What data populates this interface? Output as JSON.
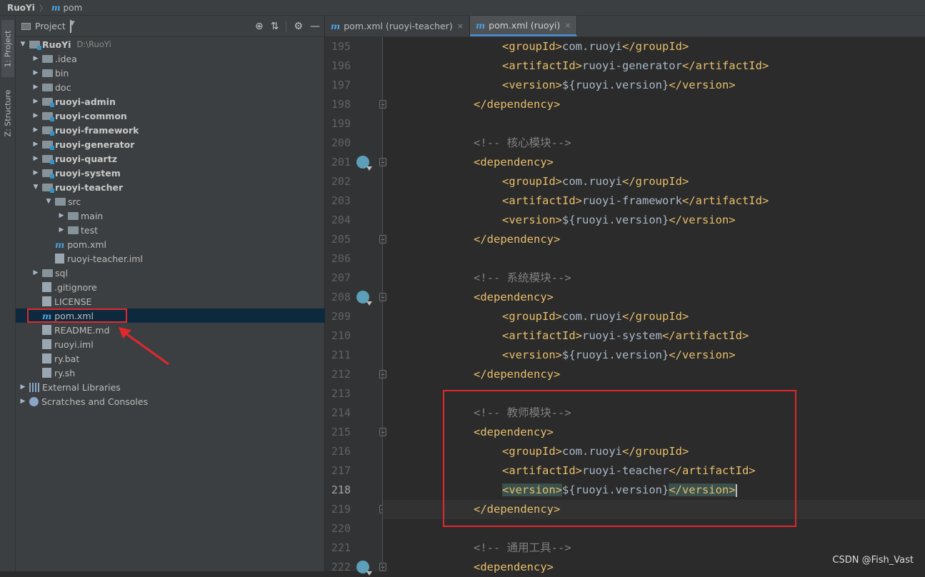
{
  "breadcrumb": {
    "root": "RuoYi",
    "separator": "〉",
    "file_icon": "m",
    "file": "pom"
  },
  "toolstrip": {
    "project_tab": "1: Project",
    "structure_tab": "Z: Structure"
  },
  "project_panel": {
    "title": "Project",
    "tree": [
      {
        "arrow": "▼",
        "label": "RuoYi",
        "bold": true,
        "path": "D:\\RuoYi",
        "indent": 0,
        "icon": "folder-module"
      },
      {
        "arrow": "▶",
        "label": ".idea",
        "indent": 1,
        "icon": "folder"
      },
      {
        "arrow": "▶",
        "label": "bin",
        "indent": 1,
        "icon": "folder"
      },
      {
        "arrow": "▶",
        "label": "doc",
        "indent": 1,
        "icon": "folder"
      },
      {
        "arrow": "▶",
        "label": "ruoyi-admin",
        "bold": true,
        "indent": 1,
        "icon": "folder-module"
      },
      {
        "arrow": "▶",
        "label": "ruoyi-common",
        "bold": true,
        "indent": 1,
        "icon": "folder-module"
      },
      {
        "arrow": "▶",
        "label": "ruoyi-framework",
        "bold": true,
        "indent": 1,
        "icon": "folder-module"
      },
      {
        "arrow": "▶",
        "label": "ruoyi-generator",
        "bold": true,
        "indent": 1,
        "icon": "folder-module"
      },
      {
        "arrow": "▶",
        "label": "ruoyi-quartz",
        "bold": true,
        "indent": 1,
        "icon": "folder-module"
      },
      {
        "arrow": "▶",
        "label": "ruoyi-system",
        "bold": true,
        "indent": 1,
        "icon": "folder-module"
      },
      {
        "arrow": "▼",
        "label": "ruoyi-teacher",
        "bold": true,
        "indent": 1,
        "icon": "folder-module"
      },
      {
        "arrow": "▼",
        "label": "src",
        "indent": 2,
        "icon": "folder"
      },
      {
        "arrow": "▶",
        "label": "main",
        "indent": 3,
        "icon": "folder"
      },
      {
        "arrow": "▶",
        "label": "test",
        "indent": 3,
        "icon": "folder"
      },
      {
        "arrow": "",
        "label": "pom.xml",
        "indent": 2,
        "icon": "maven"
      },
      {
        "arrow": "",
        "label": "ruoyi-teacher.iml",
        "indent": 2,
        "icon": "file"
      },
      {
        "arrow": "▶",
        "label": "sql",
        "indent": 1,
        "icon": "folder"
      },
      {
        "arrow": "",
        "label": ".gitignore",
        "indent": 1,
        "icon": "file"
      },
      {
        "arrow": "",
        "label": "LICENSE",
        "indent": 1,
        "icon": "file"
      },
      {
        "arrow": "",
        "label": "pom.xml",
        "indent": 1,
        "icon": "maven",
        "selected": true
      },
      {
        "arrow": "",
        "label": "README.md",
        "indent": 1,
        "icon": "file"
      },
      {
        "arrow": "",
        "label": "ruoyi.iml",
        "indent": 1,
        "icon": "file"
      },
      {
        "arrow": "",
        "label": "ry.bat",
        "indent": 1,
        "icon": "file"
      },
      {
        "arrow": "",
        "label": "ry.sh",
        "indent": 1,
        "icon": "file"
      },
      {
        "arrow": "▶",
        "label": "External Libraries",
        "indent": 0,
        "icon": "libraries"
      },
      {
        "arrow": "▶",
        "label": "Scratches and Consoles",
        "indent": 0,
        "icon": "scratches"
      }
    ]
  },
  "editor": {
    "tabs": [
      {
        "icon": "m",
        "label": "pom.xml (ruoyi-teacher)",
        "close": "×",
        "active": false
      },
      {
        "icon": "m",
        "label": "pom.xml (ruoyi)",
        "close": "×",
        "active": true
      }
    ],
    "current_line": 218,
    "lines": [
      {
        "n": "195",
        "indent": 2,
        "parts": [
          [
            "tg",
            "<groupId>"
          ],
          [
            "tx",
            "com.ruoyi"
          ],
          [
            "tg",
            "</groupId>"
          ]
        ]
      },
      {
        "n": "196",
        "indent": 2,
        "parts": [
          [
            "tg",
            "<artifactId>"
          ],
          [
            "tx",
            "ruoyi-generator"
          ],
          [
            "tg",
            "</artifactId>"
          ]
        ]
      },
      {
        "n": "197",
        "indent": 2,
        "parts": [
          [
            "tg",
            "<version>"
          ],
          [
            "tx",
            "${ruoyi.version}"
          ],
          [
            "tg",
            "</version>"
          ]
        ]
      },
      {
        "n": "198",
        "indent": 1,
        "fold": true,
        "parts": [
          [
            "tg",
            "</dependency>"
          ]
        ]
      },
      {
        "n": "199",
        "indent": 0,
        "parts": []
      },
      {
        "n": "200",
        "indent": 1,
        "parts": [
          [
            "cm",
            "<!-- 核心模块-->"
          ]
        ]
      },
      {
        "n": "201",
        "indent": 1,
        "marker": true,
        "fold": true,
        "parts": [
          [
            "tg",
            "<dependency>"
          ]
        ]
      },
      {
        "n": "202",
        "indent": 2,
        "parts": [
          [
            "tg",
            "<groupId>"
          ],
          [
            "tx",
            "com.ruoyi"
          ],
          [
            "tg",
            "</groupId>"
          ]
        ]
      },
      {
        "n": "203",
        "indent": 2,
        "parts": [
          [
            "tg",
            "<artifactId>"
          ],
          [
            "tx",
            "ruoyi-framework"
          ],
          [
            "tg",
            "</artifactId>"
          ]
        ]
      },
      {
        "n": "204",
        "indent": 2,
        "parts": [
          [
            "tg",
            "<version>"
          ],
          [
            "tx",
            "${ruoyi.version}"
          ],
          [
            "tg",
            "</version>"
          ]
        ]
      },
      {
        "n": "205",
        "indent": 1,
        "fold": true,
        "parts": [
          [
            "tg",
            "</dependency>"
          ]
        ]
      },
      {
        "n": "206",
        "indent": 0,
        "parts": []
      },
      {
        "n": "207",
        "indent": 1,
        "parts": [
          [
            "cm",
            "<!-- 系统模块-->"
          ]
        ]
      },
      {
        "n": "208",
        "indent": 1,
        "marker": true,
        "fold": true,
        "parts": [
          [
            "tg",
            "<dependency>"
          ]
        ]
      },
      {
        "n": "209",
        "indent": 2,
        "parts": [
          [
            "tg",
            "<groupId>"
          ],
          [
            "tx",
            "com.ruoyi"
          ],
          [
            "tg",
            "</groupId>"
          ]
        ]
      },
      {
        "n": "210",
        "indent": 2,
        "parts": [
          [
            "tg",
            "<artifactId>"
          ],
          [
            "tx",
            "ruoyi-system"
          ],
          [
            "tg",
            "</artifactId>"
          ]
        ]
      },
      {
        "n": "211",
        "indent": 2,
        "parts": [
          [
            "tg",
            "<version>"
          ],
          [
            "tx",
            "${ruoyi.version}"
          ],
          [
            "tg",
            "</version>"
          ]
        ]
      },
      {
        "n": "212",
        "indent": 1,
        "fold": true,
        "parts": [
          [
            "tg",
            "</dependency>"
          ]
        ]
      },
      {
        "n": "213",
        "indent": 0,
        "parts": []
      },
      {
        "n": "214",
        "indent": 1,
        "parts": [
          [
            "cm",
            "<!-- 教师模块-->"
          ]
        ]
      },
      {
        "n": "215",
        "indent": 1,
        "fold": true,
        "parts": [
          [
            "tg",
            "<dependency>"
          ]
        ]
      },
      {
        "n": "216",
        "indent": 2,
        "parts": [
          [
            "tg",
            "<groupId>"
          ],
          [
            "tx",
            "com.ruoyi"
          ],
          [
            "tg",
            "</groupId>"
          ]
        ]
      },
      {
        "n": "217",
        "indent": 2,
        "parts": [
          [
            "tg",
            "<artifactId>"
          ],
          [
            "tx",
            "ruoyi-teacher"
          ],
          [
            "tg",
            "</artifactId>"
          ]
        ]
      },
      {
        "n": "218",
        "indent": 2,
        "parts": [
          [
            "tg hl",
            "<version>"
          ],
          [
            "tx",
            "${ruoyi.version}"
          ],
          [
            "tg hl",
            "</version>"
          ]
        ]
      },
      {
        "n": "219",
        "indent": 1,
        "fold": true,
        "parts": [
          [
            "tg",
            "</dependency>"
          ]
        ]
      },
      {
        "n": "220",
        "indent": 0,
        "parts": []
      },
      {
        "n": "221",
        "indent": 1,
        "parts": [
          [
            "cm",
            "<!-- 通用工具-->"
          ]
        ]
      },
      {
        "n": "222",
        "indent": 1,
        "marker": true,
        "fold": true,
        "parts": [
          [
            "tg",
            "<dependency>"
          ]
        ]
      }
    ]
  },
  "watermark": "CSDN @Fish_Vast",
  "colors": {
    "highlight_box": "#e0282d",
    "tag": "#e8bf6a",
    "comment": "#808080",
    "text": "#a9b7c6"
  }
}
